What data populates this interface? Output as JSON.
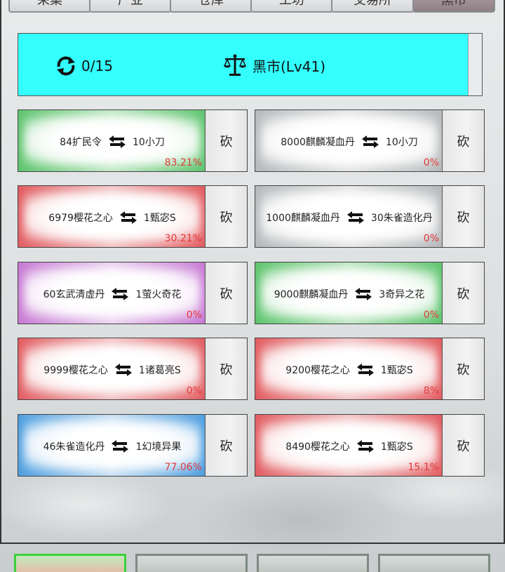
{
  "top_tabs": [
    {
      "label": "采集",
      "active": false
    },
    {
      "label": "产业",
      "active": false
    },
    {
      "label": "仓库",
      "active": false
    },
    {
      "label": "工坊",
      "active": false
    },
    {
      "label": "交易所",
      "active": false
    },
    {
      "label": "黑市",
      "active": true
    }
  ],
  "header": {
    "refresh_count": "0/15",
    "title": "黑市(Lv41)",
    "refresh_icon": "refresh-icon",
    "title_icon": "scales-icon",
    "bg_color": "#33ffff"
  },
  "trades": [
    {
      "give": "84扩民令",
      "get": "10小刀",
      "percent": "83.21%",
      "color": "green",
      "action": "砍"
    },
    {
      "give": "8000麒麟凝血丹",
      "get": "10小刀",
      "percent": "0%",
      "color": "gray",
      "action": "砍"
    },
    {
      "give": "6979樱花之心",
      "get": "1甄宓S",
      "percent": "30.21%",
      "color": "red",
      "action": "砍"
    },
    {
      "give": "1000麒麟凝血丹",
      "get": "30朱雀造化丹",
      "percent": "0%",
      "color": "gray",
      "action": "砍"
    },
    {
      "give": "60玄武清虚丹",
      "get": "1萤火奇花",
      "percent": "0%",
      "color": "purple",
      "action": "砍"
    },
    {
      "give": "9000麒麟凝血丹",
      "get": "3奇异之花",
      "percent": "0%",
      "color": "green",
      "action": "砍"
    },
    {
      "give": "9999樱花之心",
      "get": "1诸葛亮S",
      "percent": "0%",
      "color": "red",
      "action": "砍"
    },
    {
      "give": "9200樱花之心",
      "get": "1甄宓S",
      "percent": "8%",
      "color": "red",
      "action": "砍"
    },
    {
      "give": "46朱雀造化丹",
      "get": "1幻境异果",
      "percent": "77.06%",
      "color": "blue",
      "action": "砍"
    },
    {
      "give": "8490樱花之心",
      "get": "1甄宓S",
      "percent": "15.1%",
      "color": "red",
      "action": "砍"
    }
  ],
  "swap_icon": "swap-arrows-icon",
  "percent_color": "#e23a3a",
  "bottom_buttons": [
    {
      "active": true
    },
    {
      "active": false
    },
    {
      "active": false
    },
    {
      "active": false
    }
  ]
}
